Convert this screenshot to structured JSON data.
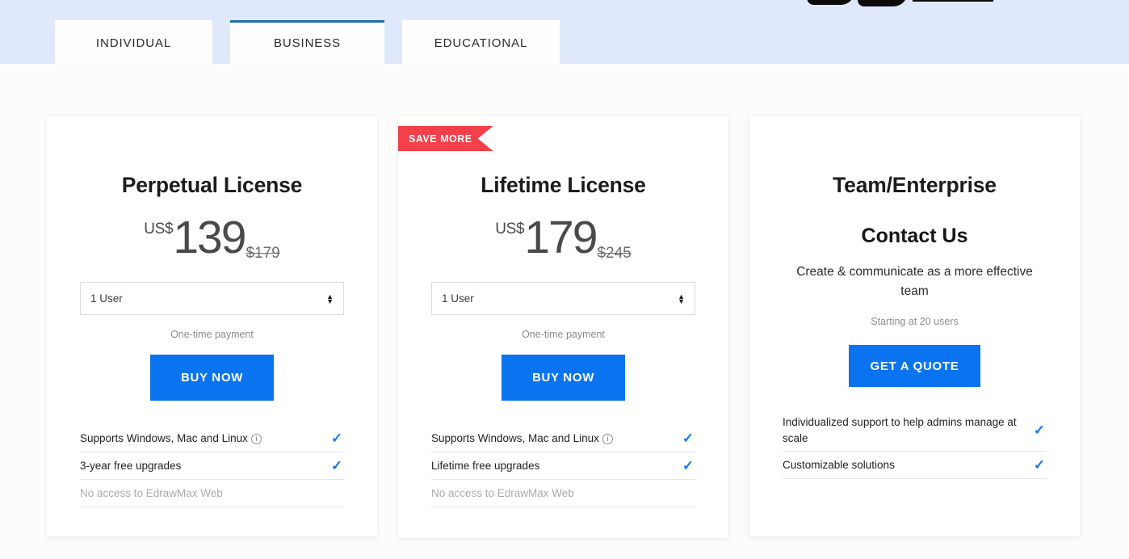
{
  "banner": {
    "tabs": [
      {
        "label": "INDIVIDUAL",
        "active": false
      },
      {
        "label": "BUSINESS",
        "active": true
      },
      {
        "label": "EDUCATIONAL",
        "active": false
      }
    ]
  },
  "colors": {
    "banner_bg": "#dfe9fb",
    "active_tab_underline": "#1a6fae",
    "cta_blue": "#0a74f0",
    "ribbon_red": "#f4404a",
    "check_blue": "#1578f2",
    "page_bg": "#fcfcfd"
  },
  "cards": [
    {
      "ribbon": "",
      "title": "Perpetual License",
      "currency": "US$",
      "price": "139",
      "old_price": "$179",
      "selector_value": "1 User",
      "selector_icon": "stepper-icon",
      "payment_note": "One-time payment",
      "cta_label": "BUY NOW",
      "features": [
        {
          "text": "Supports Windows, Mac and Linux",
          "info": true,
          "check": true,
          "muted": false
        },
        {
          "text": "3-year free upgrades",
          "info": false,
          "check": true,
          "muted": false
        },
        {
          "text": "No access to EdrawMax Web",
          "info": false,
          "check": false,
          "muted": true
        }
      ]
    },
    {
      "ribbon": "SAVE MORE",
      "title": "Lifetime License",
      "currency": "US$",
      "price": "179",
      "old_price": "$245",
      "selector_value": "1 User",
      "selector_icon": "stepper-icon",
      "payment_note": "One-time payment",
      "cta_label": "BUY NOW",
      "features": [
        {
          "text": "Supports Windows, Mac and Linux",
          "info": true,
          "check": true,
          "muted": false
        },
        {
          "text": "Lifetime free upgrades",
          "info": false,
          "check": true,
          "muted": false
        },
        {
          "text": "No access to EdrawMax Web",
          "info": false,
          "check": false,
          "muted": true
        }
      ]
    },
    {
      "title": "Team/Enterprise",
      "contact_heading": "Contact Us",
      "description": "Create & communicate as a more effective team",
      "note": "Starting at 20 users",
      "cta_label": "GET A QUOTE",
      "features": [
        {
          "text": "Individualized support to help admins manage at scale",
          "info": false,
          "check": true,
          "muted": false
        },
        {
          "text": "Customizable solutions",
          "info": false,
          "check": true,
          "muted": false
        }
      ]
    }
  ]
}
